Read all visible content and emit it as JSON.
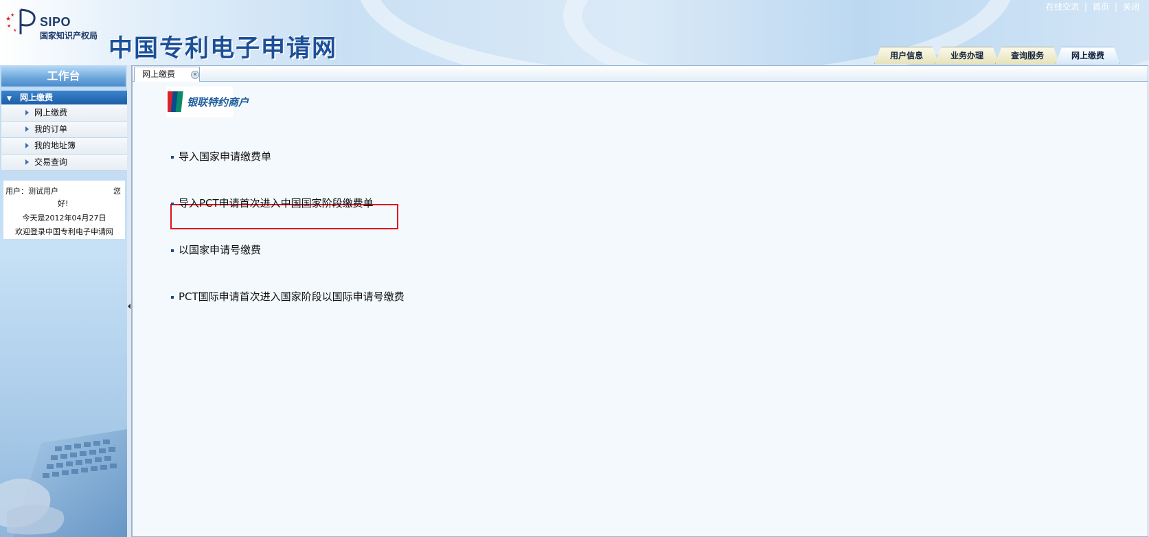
{
  "header": {
    "logo_abbr": "SIPO",
    "logo_org": "国家知识产权局",
    "site_title": "中国专利电子申请网",
    "top_links": [
      "在线交流",
      "首页",
      "关闭"
    ],
    "tabs": [
      {
        "label": "用户信息",
        "active": false
      },
      {
        "label": "业务办理",
        "active": false
      },
      {
        "label": "查询服务",
        "active": false
      },
      {
        "label": "网上缴费",
        "active": true
      }
    ]
  },
  "sidebar": {
    "workbench_title": "工作台",
    "section_title": "网上缴费",
    "items": [
      {
        "label": "网上缴费"
      },
      {
        "label": "我的订单"
      },
      {
        "label": "我的地址簿"
      },
      {
        "label": "交易查询"
      }
    ],
    "user_info": {
      "line1": "用户：测试用户",
      "line1_tail": "您",
      "line2": "好!",
      "date_line": "今天是2012年04月27日",
      "welcome": "欢迎登录中国专利电子申请网"
    }
  },
  "content": {
    "tab_label": "网上缴费",
    "merchant_badge_text": "银联特约商户",
    "links": [
      {
        "label": "导入国家申请缴费单",
        "highlighted": false
      },
      {
        "label": "导入PCT申请首次进入中国国家阶段缴费单",
        "highlighted": true
      },
      {
        "label": "以国家申请号缴费",
        "highlighted": false
      },
      {
        "label": "PCT国际申请首次进入国家阶段以国际申请号缴费",
        "highlighted": false
      }
    ]
  },
  "colors": {
    "accent_blue": "#1b4f99",
    "highlight_border": "#e0101c",
    "tab_background": "#e6e3bd"
  }
}
